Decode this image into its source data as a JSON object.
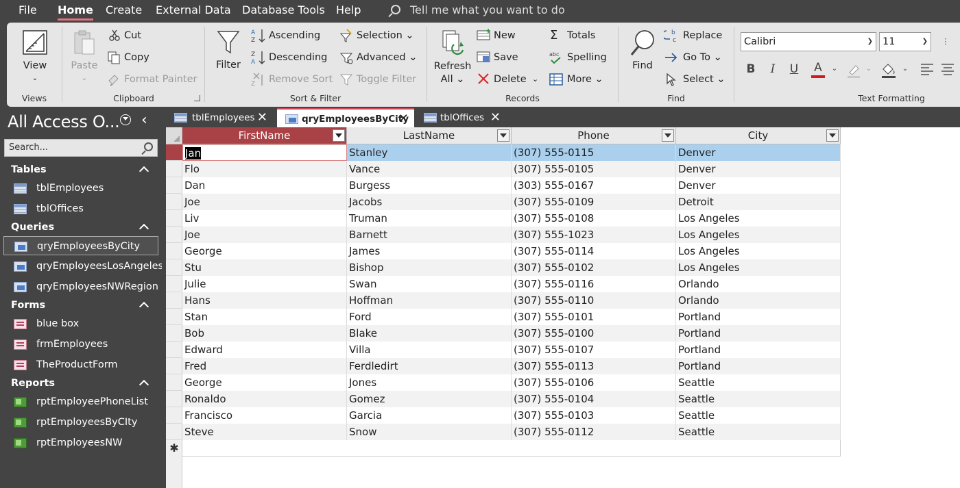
{
  "menubar": {
    "items": [
      "File",
      "Home",
      "Create",
      "External Data",
      "Database Tools",
      "Help"
    ],
    "active": "Home",
    "tellme": "Tell me what you want to do"
  },
  "ribbon": {
    "views": {
      "view": "View",
      "group": "Views"
    },
    "clipboard": {
      "paste": "Paste",
      "cut": "Cut",
      "copy": "Copy",
      "format_painter": "Format Painter",
      "group": "Clipboard"
    },
    "sort_filter": {
      "filter": "Filter",
      "ascending": "Ascending",
      "descending": "Descending",
      "remove_sort": "Remove Sort",
      "selection": "Selection",
      "advanced": "Advanced",
      "toggle_filter": "Toggle Filter",
      "group": "Sort & Filter"
    },
    "records": {
      "refresh_1": "Refresh",
      "refresh_2": "All",
      "new": "New",
      "save": "Save",
      "delete": "Delete",
      "totals": "Totals",
      "spelling": "Spelling",
      "more": "More",
      "group": "Records"
    },
    "find": {
      "find": "Find",
      "replace": "Replace",
      "goto": "Go To",
      "select": "Select",
      "group": "Find"
    },
    "text_formatting": {
      "font": "Calibri",
      "size": "11",
      "group": "Text Formatting",
      "font_color": "#d01c1c"
    }
  },
  "nav": {
    "title": "All Access O...",
    "search_placeholder": "Search...",
    "sections": [
      {
        "label": "Tables",
        "items": [
          "tblEmployees",
          "tblOffices"
        ]
      },
      {
        "label": "Queries",
        "items": [
          "qryEmployeesByCity",
          "qryEmployeesLosAngeles",
          "qryEmployeesNWRegion"
        ]
      },
      {
        "label": "Forms",
        "items": [
          "blue box",
          "frmEmployees",
          "TheProductForm"
        ]
      },
      {
        "label": "Reports",
        "items": [
          "rptEmployeePhoneList",
          "rptEmployeesByCIty",
          "rptEmployeesNW"
        ]
      }
    ],
    "selected": "qryEmployeesByCity"
  },
  "tabs": [
    {
      "label": "tblEmployees",
      "type": "table"
    },
    {
      "label": "qryEmployeesByCity",
      "type": "query",
      "active": true
    },
    {
      "label": "tblOffices",
      "type": "table"
    }
  ],
  "datasheet": {
    "columns": [
      "FirstName",
      "LastName",
      "Phone",
      "City"
    ],
    "rows": [
      [
        "Jan",
        "Stanley",
        "(307) 555-0115",
        "Denver"
      ],
      [
        "Flo",
        "Vance",
        "(307) 555-0105",
        "Denver"
      ],
      [
        "Dan",
        "Burgess",
        "(303) 555-0167",
        "Denver"
      ],
      [
        "Joe",
        "Jacobs",
        "(307) 555-0109",
        "Detroit"
      ],
      [
        "Liv",
        "Truman",
        "(307) 555-0108",
        "Los Angeles"
      ],
      [
        "Joe",
        "Barnett",
        "(307) 555-1023",
        "Los Angeles"
      ],
      [
        "George",
        "James",
        "(307) 555-0114",
        "Los Angeles"
      ],
      [
        "Stu",
        "Bishop",
        "(307) 555-0102",
        "Los Angeles"
      ],
      [
        "Julie",
        "Swan",
        "(307) 555-0116",
        "Orlando"
      ],
      [
        "Hans",
        "Hoffman",
        "(307) 555-0110",
        "Orlando"
      ],
      [
        "Stan",
        "Ford",
        "(307) 555-0101",
        "Portland"
      ],
      [
        "Bob",
        "Blake",
        "(307) 555-0100",
        "Portland"
      ],
      [
        "Edward",
        "Villa",
        "(307) 555-0107",
        "Portland"
      ],
      [
        "Fred",
        "Ferdledirt",
        "(307) 555-0113",
        "Portland"
      ],
      [
        "George",
        "Jones",
        "(307) 555-0106",
        "Seattle"
      ],
      [
        "Ronaldo",
        "Gomez",
        "(307) 555-0104",
        "Seattle"
      ],
      [
        "Francisco",
        "Garcia",
        "(307) 555-0103",
        "Seattle"
      ],
      [
        "Steve",
        "Snow",
        "(307) 555-0112",
        "Seattle"
      ]
    ],
    "new_row_symbol": "✱",
    "accent": "#a94246",
    "selected_row_color": "#abd0ee"
  }
}
